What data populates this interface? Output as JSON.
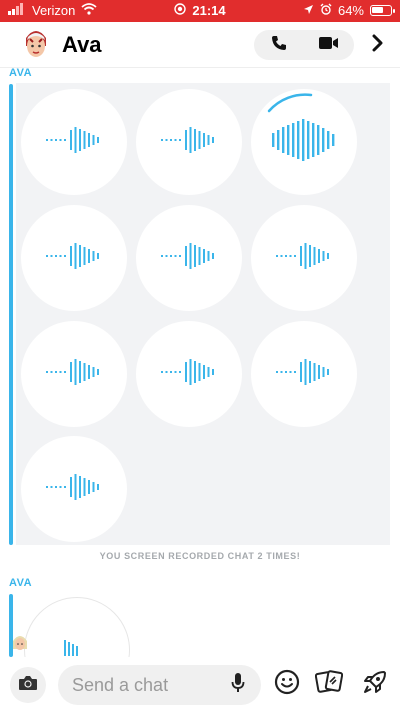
{
  "status_bar": {
    "carrier": "Verizon",
    "time": "21:14",
    "battery": "64%",
    "battery_level": 0.64,
    "background_color": "#e12d2d"
  },
  "header": {
    "contact_name": "Ava",
    "icons": [
      "bitmoji-avatar-icon",
      "phone-icon",
      "video-camera-icon",
      "chevron-right-icon"
    ]
  },
  "chat": {
    "sender_label": "AVA",
    "voice_notes": [
      {
        "state": "idle"
      },
      {
        "state": "idle"
      },
      {
        "state": "playing"
      },
      {
        "state": "idle"
      },
      {
        "state": "idle"
      },
      {
        "state": "idle"
      },
      {
        "state": "idle"
      },
      {
        "state": "idle"
      },
      {
        "state": "idle"
      },
      {
        "state": "idle"
      }
    ],
    "system_message": "YOU SCREEN RECORDED CHAT 2 TIMES!",
    "second_sender_label": "AVA",
    "accent_color": "#3ab5ea"
  },
  "composer": {
    "placeholder": "Send a chat",
    "icons": [
      "camera-icon",
      "microphone-icon",
      "smiley-icon",
      "cards-icon",
      "rocket-icon"
    ]
  }
}
